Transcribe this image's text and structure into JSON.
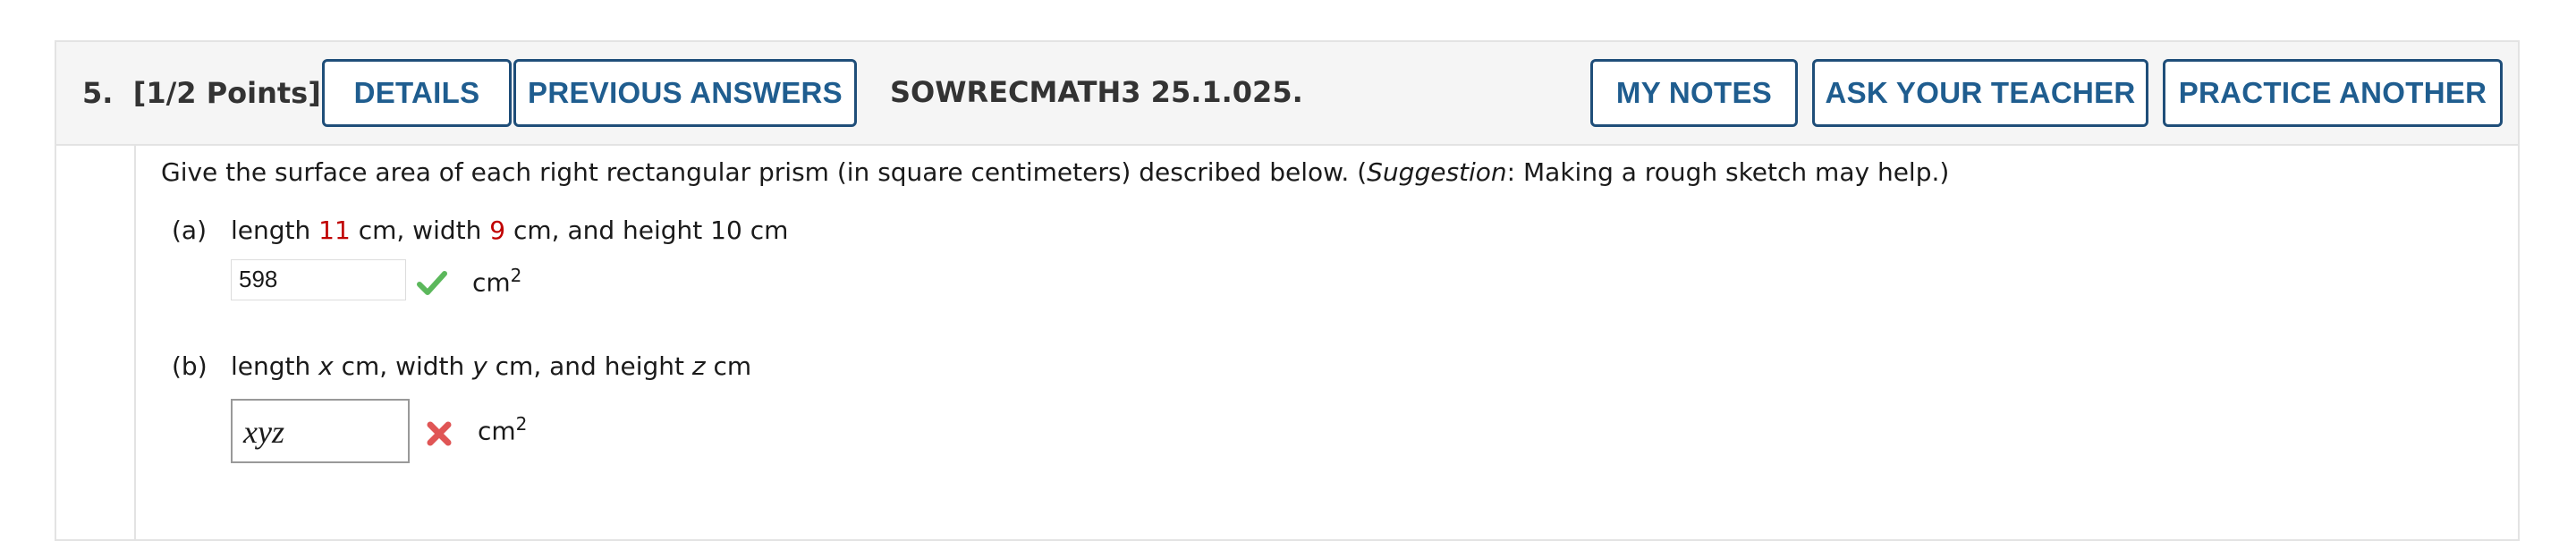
{
  "question": {
    "number": "5.",
    "points": "[1/2 Points]",
    "code": "SOWRECMATH3 25.1.025."
  },
  "buttons": {
    "details": "DETAILS",
    "previous_answers": "PREVIOUS ANSWERS",
    "my_notes": "MY NOTES",
    "ask_teacher": "ASK YOUR TEACHER",
    "practice_another": "PRACTICE ANOTHER"
  },
  "instruction": {
    "main": "Give the surface area of each right rectangular prism (in square centimeters) described below. (",
    "suggestion_word": "Suggestion",
    "rest": ": Making a rough sketch may help.)"
  },
  "part_a": {
    "label": "(a)",
    "pre_length": "length ",
    "length": "11",
    "pre_width": " cm, width ",
    "width": "9",
    "post": " cm, and height 10 cm",
    "answer": "598",
    "unit": "cm",
    "unit_exp": "2",
    "status": "correct"
  },
  "part_b": {
    "label": "(b)",
    "t1": "length ",
    "v1": "x",
    "t2": " cm, width ",
    "v2": "y",
    "t3": " cm, and height ",
    "v3": "z",
    "t4": " cm",
    "answer": "xyz",
    "unit": "cm",
    "unit_exp": "2",
    "status": "incorrect"
  },
  "colors": {
    "button_text": "#1f5d8f",
    "button_border": "#1f4e79",
    "given_value": "#c00000",
    "check": "#5cb85c",
    "cross": "#e05555"
  },
  "icons": {
    "correct": "check-icon",
    "incorrect": "cross-icon"
  }
}
